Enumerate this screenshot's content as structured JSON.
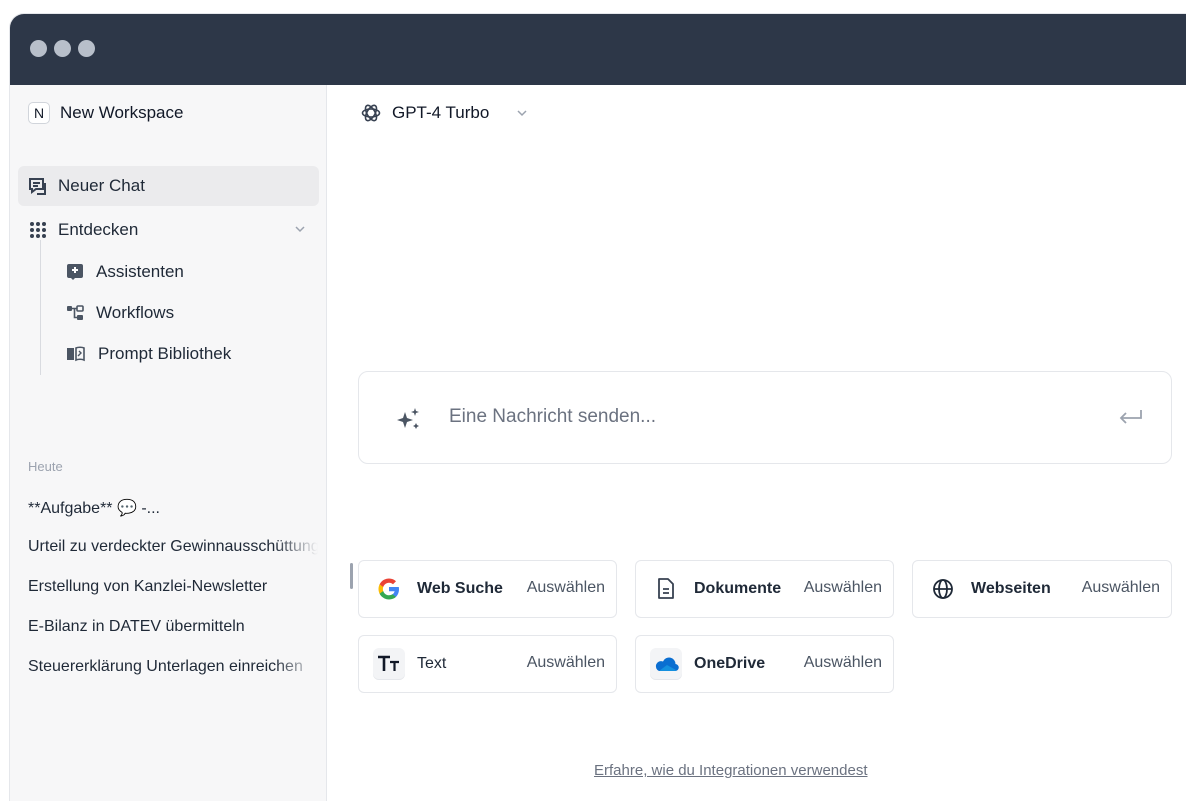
{
  "sidebar": {
    "workspace": {
      "initial": "N",
      "name": "New Workspace"
    },
    "new_chat": "Neuer Chat",
    "discover": "Entdecken",
    "sub_items": [
      "Assistenten",
      "Workflows",
      "Prompt Bibliothek"
    ],
    "section_today": "Heute",
    "chats": [
      "**Aufgabe** 💬 -...",
      "Urteil zu verdeckter Gewinnausschüttung",
      "Erstellung von Kanzlei-Newsletter",
      "E-Bilanz in DATEV übermitteln",
      "Steuererklärung Unterlagen einreichen"
    ]
  },
  "main": {
    "model": "GPT-4 Turbo",
    "composer_placeholder": "Eine Nachricht senden...",
    "integrations": [
      {
        "label": "Web Suche",
        "action": "Auswählen",
        "icon": "google-icon"
      },
      {
        "label": "Dokumente",
        "action": "Auswählen",
        "icon": "document-icon"
      },
      {
        "label": "Webseiten",
        "action": "Auswählen",
        "icon": "globe-icon"
      },
      {
        "label": "Text",
        "action": "Auswählen",
        "icon": "text-format-icon"
      },
      {
        "label": "OneDrive",
        "action": "Auswählen",
        "icon": "onedrive-icon"
      }
    ],
    "learn_link": "Erfahre, wie du Integrationen verwendest"
  },
  "colors": {
    "titlebar": "#2d3748",
    "sidebar_bg": "#f7f7f8",
    "active_item_bg": "#ebebed",
    "border": "#e5e7eb"
  }
}
